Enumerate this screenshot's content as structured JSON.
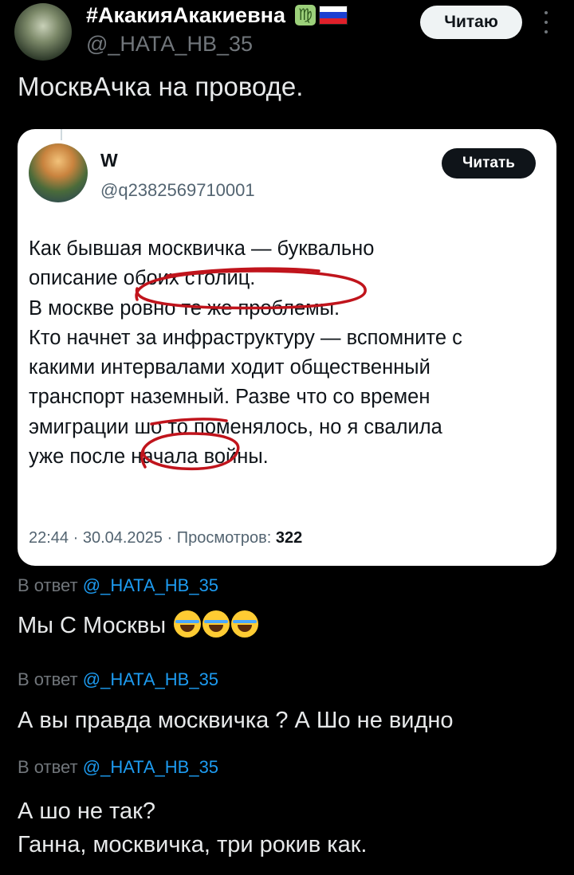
{
  "author": {
    "name": "#АкакияАкакиевна",
    "handle": "@_НАТА_НВ_35",
    "follow_label": "Читаю"
  },
  "post": {
    "text": "МосквАчка на проводе."
  },
  "quoted": {
    "name": "W",
    "handle": "@q2382569710001",
    "read_label": "Читать",
    "lines": [
      "Как бывшая москвичка — буквально",
      "описание обоих столиц.",
      "В москве ровно те же проблемы.",
      "Кто начнет за инфраструктуру — вспомните с",
      "какими интервалами ходит общественный",
      "транспорт наземный. Разве что со времен",
      "эмиграции шо то поменялось, но я свалила",
      "уже после начала войны."
    ],
    "time": "22:44 · 30.04.2025 · Просмотров: ",
    "views": "322"
  },
  "replies": [
    {
      "prefix": "В ответ ",
      "mention": "@_НАТА_НВ_35",
      "text": "Мы С Москвы"
    },
    {
      "prefix": "В ответ ",
      "mention": "@_НАТА_НВ_35",
      "text": "А вы правда москвичка ? А Шо не видно"
    },
    {
      "prefix": "В ответ ",
      "mention": "@_НАТА_НВ_35",
      "text_lines": [
        "А шо не так?",
        "Ганна, москвичка, три рокив как."
      ]
    }
  ],
  "icons": {
    "zodiac": "virgo-icon",
    "flag": "russia-flag-icon",
    "emoji": "tears-of-joy-emoji",
    "more": "more-vertical-icon"
  },
  "colors": {
    "accent": "#1d9bf0",
    "annotation": "#c0141c",
    "flag_white": "#ffffff",
    "flag_blue": "#1c3fd1",
    "flag_red": "#e0202a"
  }
}
